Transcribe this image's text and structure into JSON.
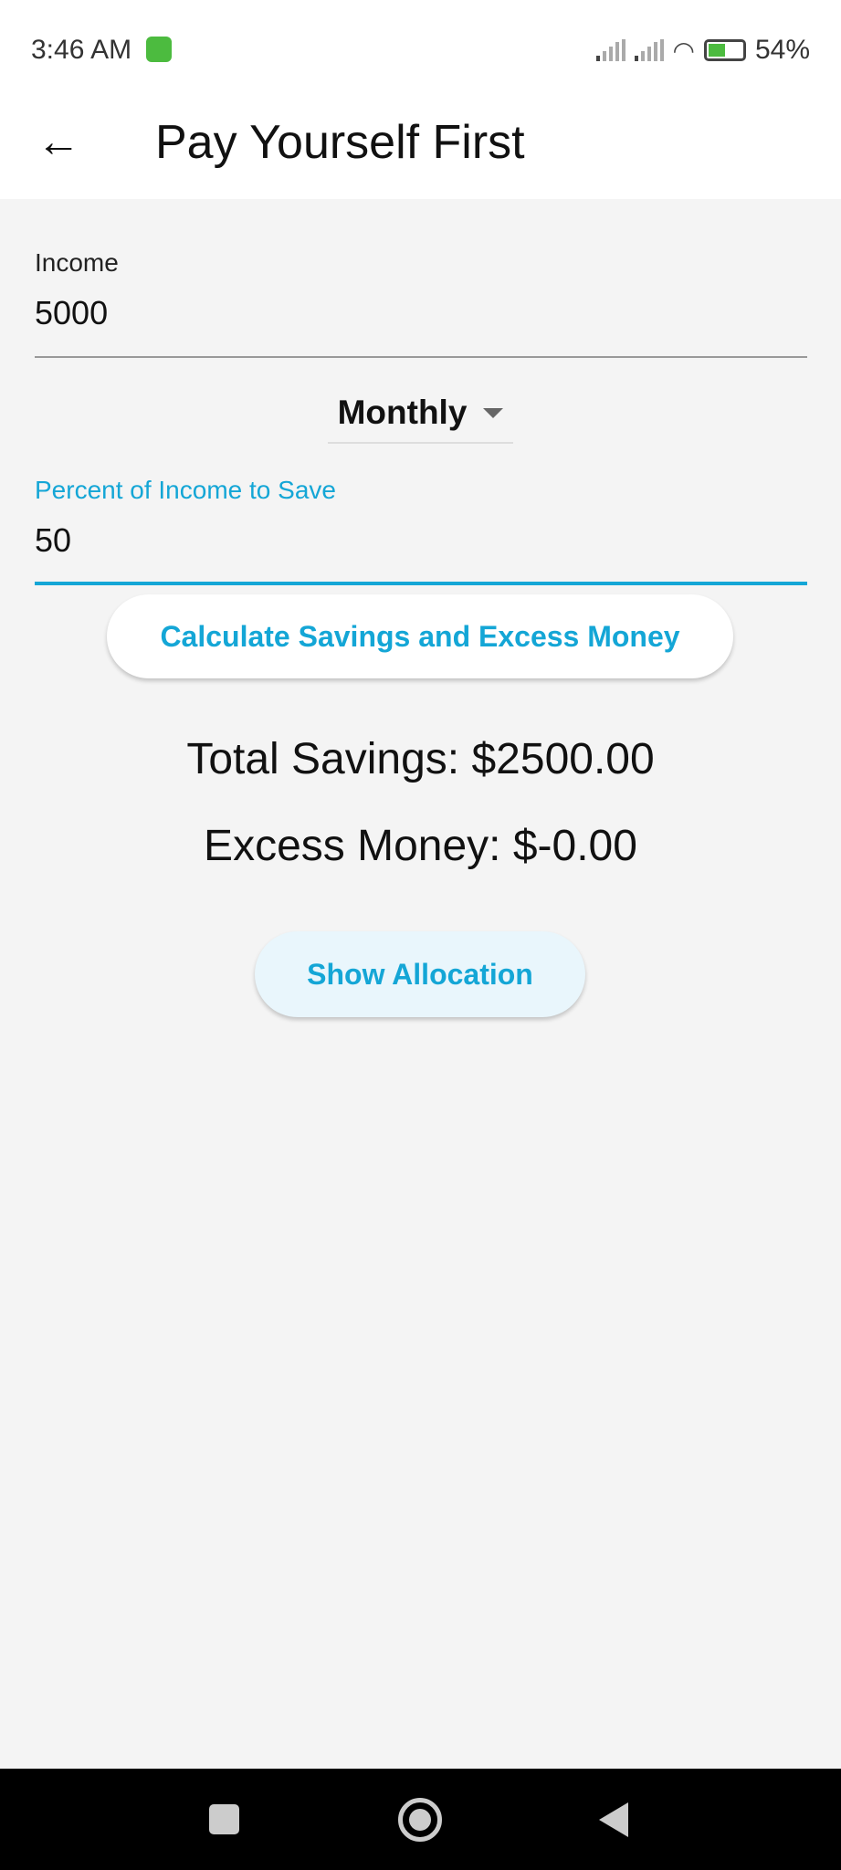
{
  "status_bar": {
    "time": "3:46 AM",
    "battery": "54%"
  },
  "app_bar": {
    "title": "Pay Yourself First"
  },
  "form": {
    "income_label": "Income",
    "income_value": "5000",
    "frequency": "Monthly",
    "percent_label": "Percent of Income to Save",
    "percent_value": "50",
    "accent_color": "#14a6d6"
  },
  "calculate_button": "Calculate Savings and Excess Money",
  "results": {
    "total_savings": "Total Savings: $2500.00",
    "excess_money": "Excess Money: $-0.00"
  },
  "show_allocation_button": "Show Allocation"
}
